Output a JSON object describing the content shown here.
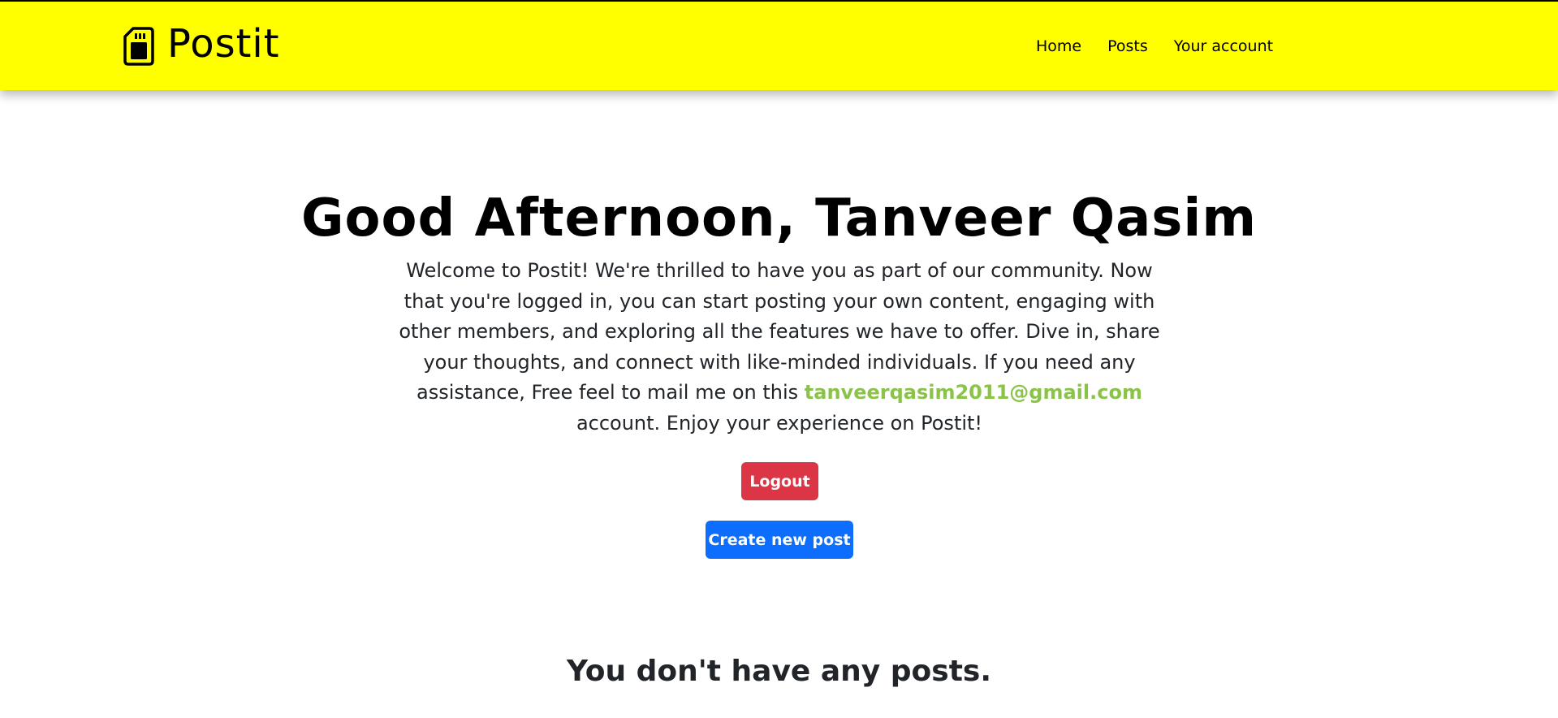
{
  "navbar": {
    "brand": "Postit",
    "brand_icon": "sd-card-icon",
    "links": [
      "Home",
      "Posts",
      "Your account"
    ]
  },
  "main": {
    "greeting": "Good Afternoon, Tanveer Qasim",
    "welcome_before_email": "Welcome to Postit! We're thrilled to have you as part of our community. Now that you're logged in, you can start posting your own content, engaging with other members, and exploring all the features we have to offer. Dive in, share your thoughts, and connect with like-minded individuals. If you need any assistance, Free feel to mail me on this ",
    "email": "tanveerqasim2011@gmail.com",
    "welcome_after_email": " account. Enjoy your experience on Postit!",
    "logout_label": "Logout",
    "create_post_label": "Create new post",
    "no_posts_text": "You don't have any posts."
  },
  "colors": {
    "navbar_background": "#ffff00",
    "email_link": "#8bc34a",
    "logout_button": "#dc3545",
    "create_button": "#0d6efd"
  }
}
